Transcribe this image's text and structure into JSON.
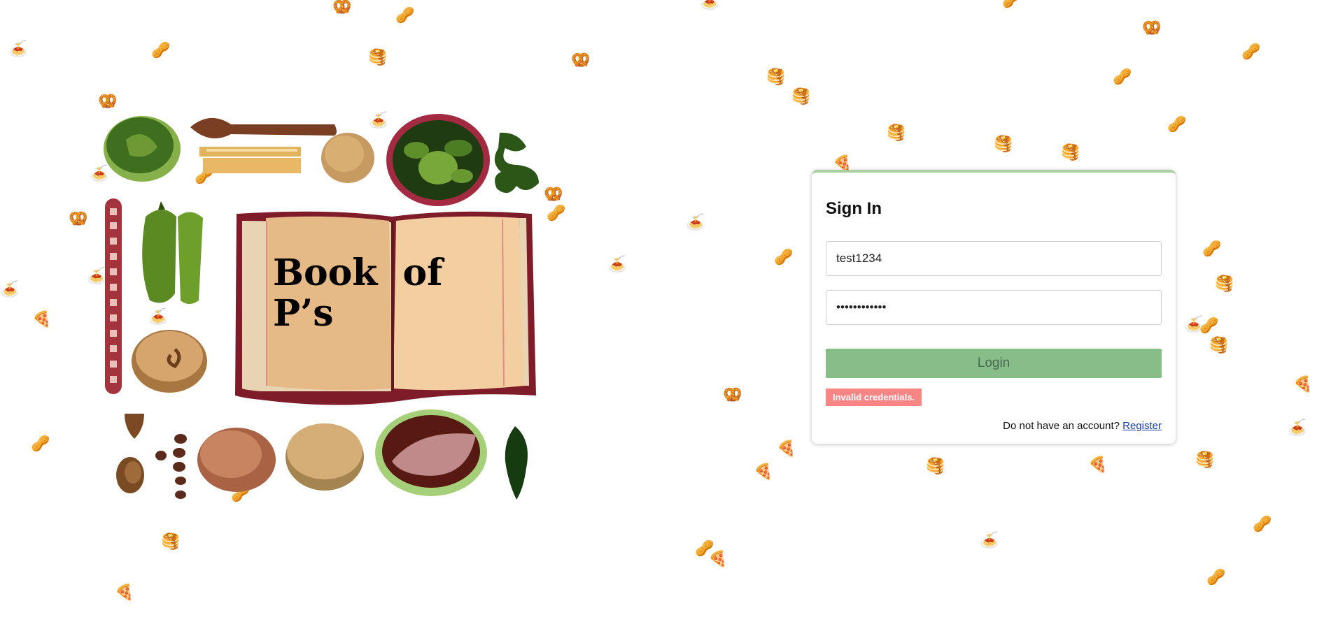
{
  "book": {
    "title": "Book of P’s"
  },
  "signin": {
    "title": "Sign In",
    "username_value": "test1234",
    "password_value": "••••••••••••",
    "login_label": "Login",
    "error_text": "Invalid credentials.",
    "register_prompt": "Do not have an account?",
    "register_link": "Register"
  },
  "colors": {
    "card_accent": "#a8cfa0",
    "login_button": "#86bd89",
    "error_badge": "#f98585",
    "register_link": "#1a3fa8"
  },
  "background_emojis": [
    "pizza-icon",
    "pretzel-icon",
    "pancakes-icon",
    "pasta-icon",
    "peanuts-icon"
  ]
}
